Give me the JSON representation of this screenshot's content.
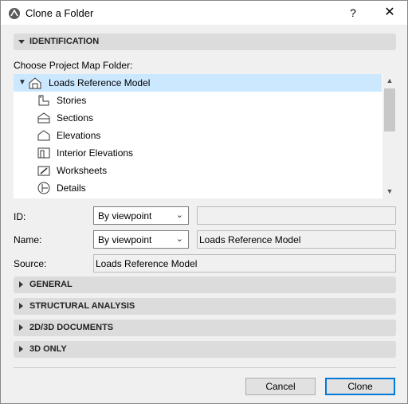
{
  "window": {
    "title": "Clone a Folder",
    "help_label": "?",
    "close_label": "✕"
  },
  "identification": {
    "header": "IDENTIFICATION",
    "choose_label": "Choose Project Map Folder:",
    "tree": [
      {
        "label": "Loads Reference Model",
        "icon": "model-house-icon",
        "selected": true
      },
      {
        "label": "Stories",
        "icon": "stories-icon"
      },
      {
        "label": "Sections",
        "icon": "sections-icon"
      },
      {
        "label": "Elevations",
        "icon": "elevations-icon"
      },
      {
        "label": "Interior Elevations",
        "icon": "interior-elevations-icon"
      },
      {
        "label": "Worksheets",
        "icon": "worksheets-icon"
      },
      {
        "label": "Details",
        "icon": "details-icon"
      }
    ],
    "id_label": "ID:",
    "id_select": "By viewpoint",
    "id_value": "",
    "name_label": "Name:",
    "name_select": "By viewpoint",
    "name_value": "Loads Reference Model",
    "source_label": "Source:",
    "source_value": "Loads Reference Model"
  },
  "sections": [
    {
      "label": "GENERAL"
    },
    {
      "label": "STRUCTURAL ANALYSIS"
    },
    {
      "label": "2D/3D DOCUMENTS"
    },
    {
      "label": "3D ONLY"
    }
  ],
  "buttons": {
    "cancel": "Cancel",
    "clone": "Clone"
  }
}
